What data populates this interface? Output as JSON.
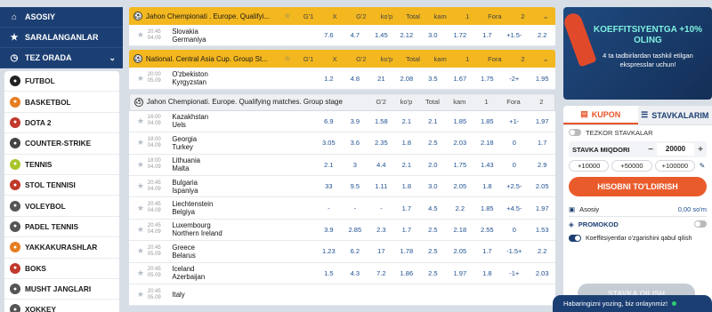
{
  "nav": {
    "items": [
      {
        "label": "ASOSIY",
        "icon": "home-icon"
      },
      {
        "label": "SARALANGANLAR",
        "icon": "star-icon"
      },
      {
        "label": "TEZ ORADA",
        "icon": "clock-icon"
      }
    ]
  },
  "sports": [
    {
      "label": "FUTBOL",
      "icon": "football-icon",
      "color": "#222222"
    },
    {
      "label": "BASKETBOL",
      "icon": "basketball-icon",
      "color": "#e67e22"
    },
    {
      "label": "DOTA 2",
      "icon": "dota-icon",
      "color": "#c0392b"
    },
    {
      "label": "COUNTER-STRIKE",
      "icon": "counter-strike-icon",
      "color": "#444444"
    },
    {
      "label": "TENNIS",
      "icon": "tennis-icon",
      "color": "#a8c62b"
    },
    {
      "label": "STOL TENNISI",
      "icon": "table-tennis-icon",
      "color": "#c0392b"
    },
    {
      "label": "VOLEYBOL",
      "icon": "volleyball-icon",
      "color": "#555555"
    },
    {
      "label": "PADEL TENNIS",
      "icon": "padel-tennis-icon",
      "color": "#555555"
    },
    {
      "label": "YAKKAKURASHLAR",
      "icon": "martial-arts-icon",
      "color": "#e67e22"
    },
    {
      "label": "BOKS",
      "icon": "boxing-icon",
      "color": "#c0392b"
    },
    {
      "label": "MUSHT JANGLARI",
      "icon": "fist-fight-icon",
      "color": "#555555"
    },
    {
      "label": "XOKKEY",
      "icon": "hockey-icon",
      "color": "#555555"
    }
  ],
  "columns_a": [
    "G'1",
    "X",
    "G'2",
    "ko'p",
    "Total",
    "kam",
    "1",
    "Fora",
    "2"
  ],
  "columns_b": [
    "G'2",
    "ko'p",
    "Total",
    "kam",
    "1",
    "Fora",
    "2"
  ],
  "blocks": [
    {
      "league": "Jahon Chempionati . Europe. Qualifyi...",
      "style": "yellow",
      "matches": [
        {
          "time": "20:45",
          "date": "04.09",
          "home": "Slovakia",
          "away": "Germaniya",
          "odds": [
            "7.6",
            "4.7",
            "1.45",
            "2.12",
            "3.0",
            "1.72",
            "1.7",
            "+1.5-",
            "2.2"
          ]
        }
      ]
    },
    {
      "league": "National. Central Asia Cup. Group St...",
      "style": "yellow",
      "matches": [
        {
          "time": "20:00",
          "date": "05.09",
          "home": "O'zbekiston",
          "away": "Kyrgyzstan",
          "odds": [
            "1.2",
            "4.8",
            "21",
            "2.08",
            "3.5",
            "1.67",
            "1.75",
            "-2+",
            "1.95"
          ]
        }
      ]
    },
    {
      "league": "Jahon Chempionati. Europe. Qualifying matches. Group stage",
      "style": "grey",
      "matches": [
        {
          "time": "16:00",
          "date": "04.09",
          "home": "Kazakhstan",
          "away": "Uels",
          "odds": [
            "6.9",
            "3.9",
            "1.58",
            "2.1",
            "2.1",
            "1.85",
            "1.85",
            "+1-",
            "1.97"
          ]
        },
        {
          "time": "18:00",
          "date": "04.09",
          "home": "Georgia",
          "away": "Turkey",
          "odds": [
            "3.05",
            "3.6",
            "2.35",
            "1.8",
            "2.5",
            "2.03",
            "2.18",
            "0",
            "1.7"
          ]
        },
        {
          "time": "18:00",
          "date": "04.09",
          "home": "Lithuania",
          "away": "Malta",
          "odds": [
            "2.1",
            "3",
            "4.4",
            "2.1",
            "2.0",
            "1.75",
            "1.43",
            "0",
            "2.9"
          ]
        },
        {
          "time": "20:45",
          "date": "04.09",
          "home": "Bulgaria",
          "away": "Ispaniya",
          "odds": [
            "33",
            "9.5",
            "1.11",
            "1.8",
            "3.0",
            "2.05",
            "1.8",
            "+2.5-",
            "2.05"
          ]
        },
        {
          "time": "20:45",
          "date": "04.09",
          "home": "Liechtenstein",
          "away": "Belgiya",
          "odds": [
            "-",
            "-",
            "-",
            "1.7",
            "4.5",
            "2.2",
            "1.85",
            "+4.5-",
            "1.97"
          ]
        },
        {
          "time": "20:45",
          "date": "04.09",
          "home": "Luxembourg",
          "away": "Northern Ireland",
          "odds": [
            "3.9",
            "2.85",
            "2.3",
            "1.7",
            "2.5",
            "2.18",
            "2.55",
            "0",
            "1.53"
          ]
        },
        {
          "time": "20:45",
          "date": "05.09",
          "home": "Greece",
          "away": "Belarus",
          "odds": [
            "1.23",
            "6.2",
            "17",
            "1.78",
            "2.5",
            "2.05",
            "1.7",
            "-1.5+",
            "2.2"
          ]
        },
        {
          "time": "20:45",
          "date": "05.09",
          "home": "Iceland",
          "away": "Azerbaijan",
          "odds": [
            "1.5",
            "4.3",
            "7.2",
            "1.86",
            "2.5",
            "1.97",
            "1.8",
            "-1+",
            "2.03"
          ]
        },
        {
          "time": "20:45",
          "date": "05.09",
          "home": "Italy",
          "away": "",
          "odds": [
            "",
            "",
            "",
            "",
            "",
            "",
            "",
            "",
            ""
          ]
        }
      ]
    }
  ],
  "promo": {
    "title": "KOEFFITSIYENTGA +10% OLING",
    "text": "4 ta tadbirlardan tashkil etilgan ekspresslar uchun!"
  },
  "coupon": {
    "tab_coupon": "KUPON",
    "tab_bets": "STAVKALARIM",
    "quick_bets_label": "TEZKOR STAVKALAR",
    "stake_label": "STAVKA MIQDORI",
    "stake_minus": "−",
    "stake_plus": "+",
    "stake_value": "20000",
    "quick_amounts": [
      "+10000",
      "+50000",
      "+100000"
    ],
    "fill_button": "HISOBNI TO'LDIRISH",
    "balance_label": "Asosiy",
    "balance_value": "0,00 so'm",
    "promocode_label": "PROMOKOD",
    "accept_odds_label": "Koeffitsiyentlar o'zgarishini qabul qilish",
    "submit_button": "STAVKA QILISH"
  },
  "chat": {
    "label": "Habaringizni yozing, biz onlaynmiz!"
  }
}
